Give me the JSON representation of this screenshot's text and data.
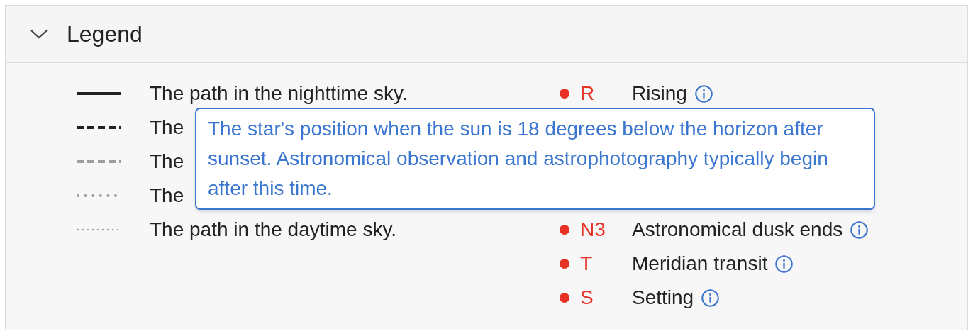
{
  "panel": {
    "title": "Legend",
    "expanded": true
  },
  "paths": [
    {
      "kind": "solid",
      "label": "The path in the nighttime sky."
    },
    {
      "kind": "dashed",
      "label": "The"
    },
    {
      "kind": "dashed-light",
      "label": "The"
    },
    {
      "kind": "dotted",
      "label": "The"
    },
    {
      "kind": "dotted-fine",
      "label": "The path in the daytime sky."
    }
  ],
  "markers": [
    {
      "code": "R",
      "label": "Rising",
      "color": "#e53224"
    },
    {
      "code": "N3",
      "label": "Astronomical dusk ends",
      "color": "#e53224"
    },
    {
      "code": "T",
      "label": "Meridian transit",
      "color": "#e53224"
    },
    {
      "code": "S",
      "label": "Setting",
      "color": "#e53224"
    }
  ],
  "tooltip": {
    "text": "The star's position when the sun is 18 degrees below the horizon after sunset. Astronomical observation and astrophotography typically begin after this time."
  }
}
